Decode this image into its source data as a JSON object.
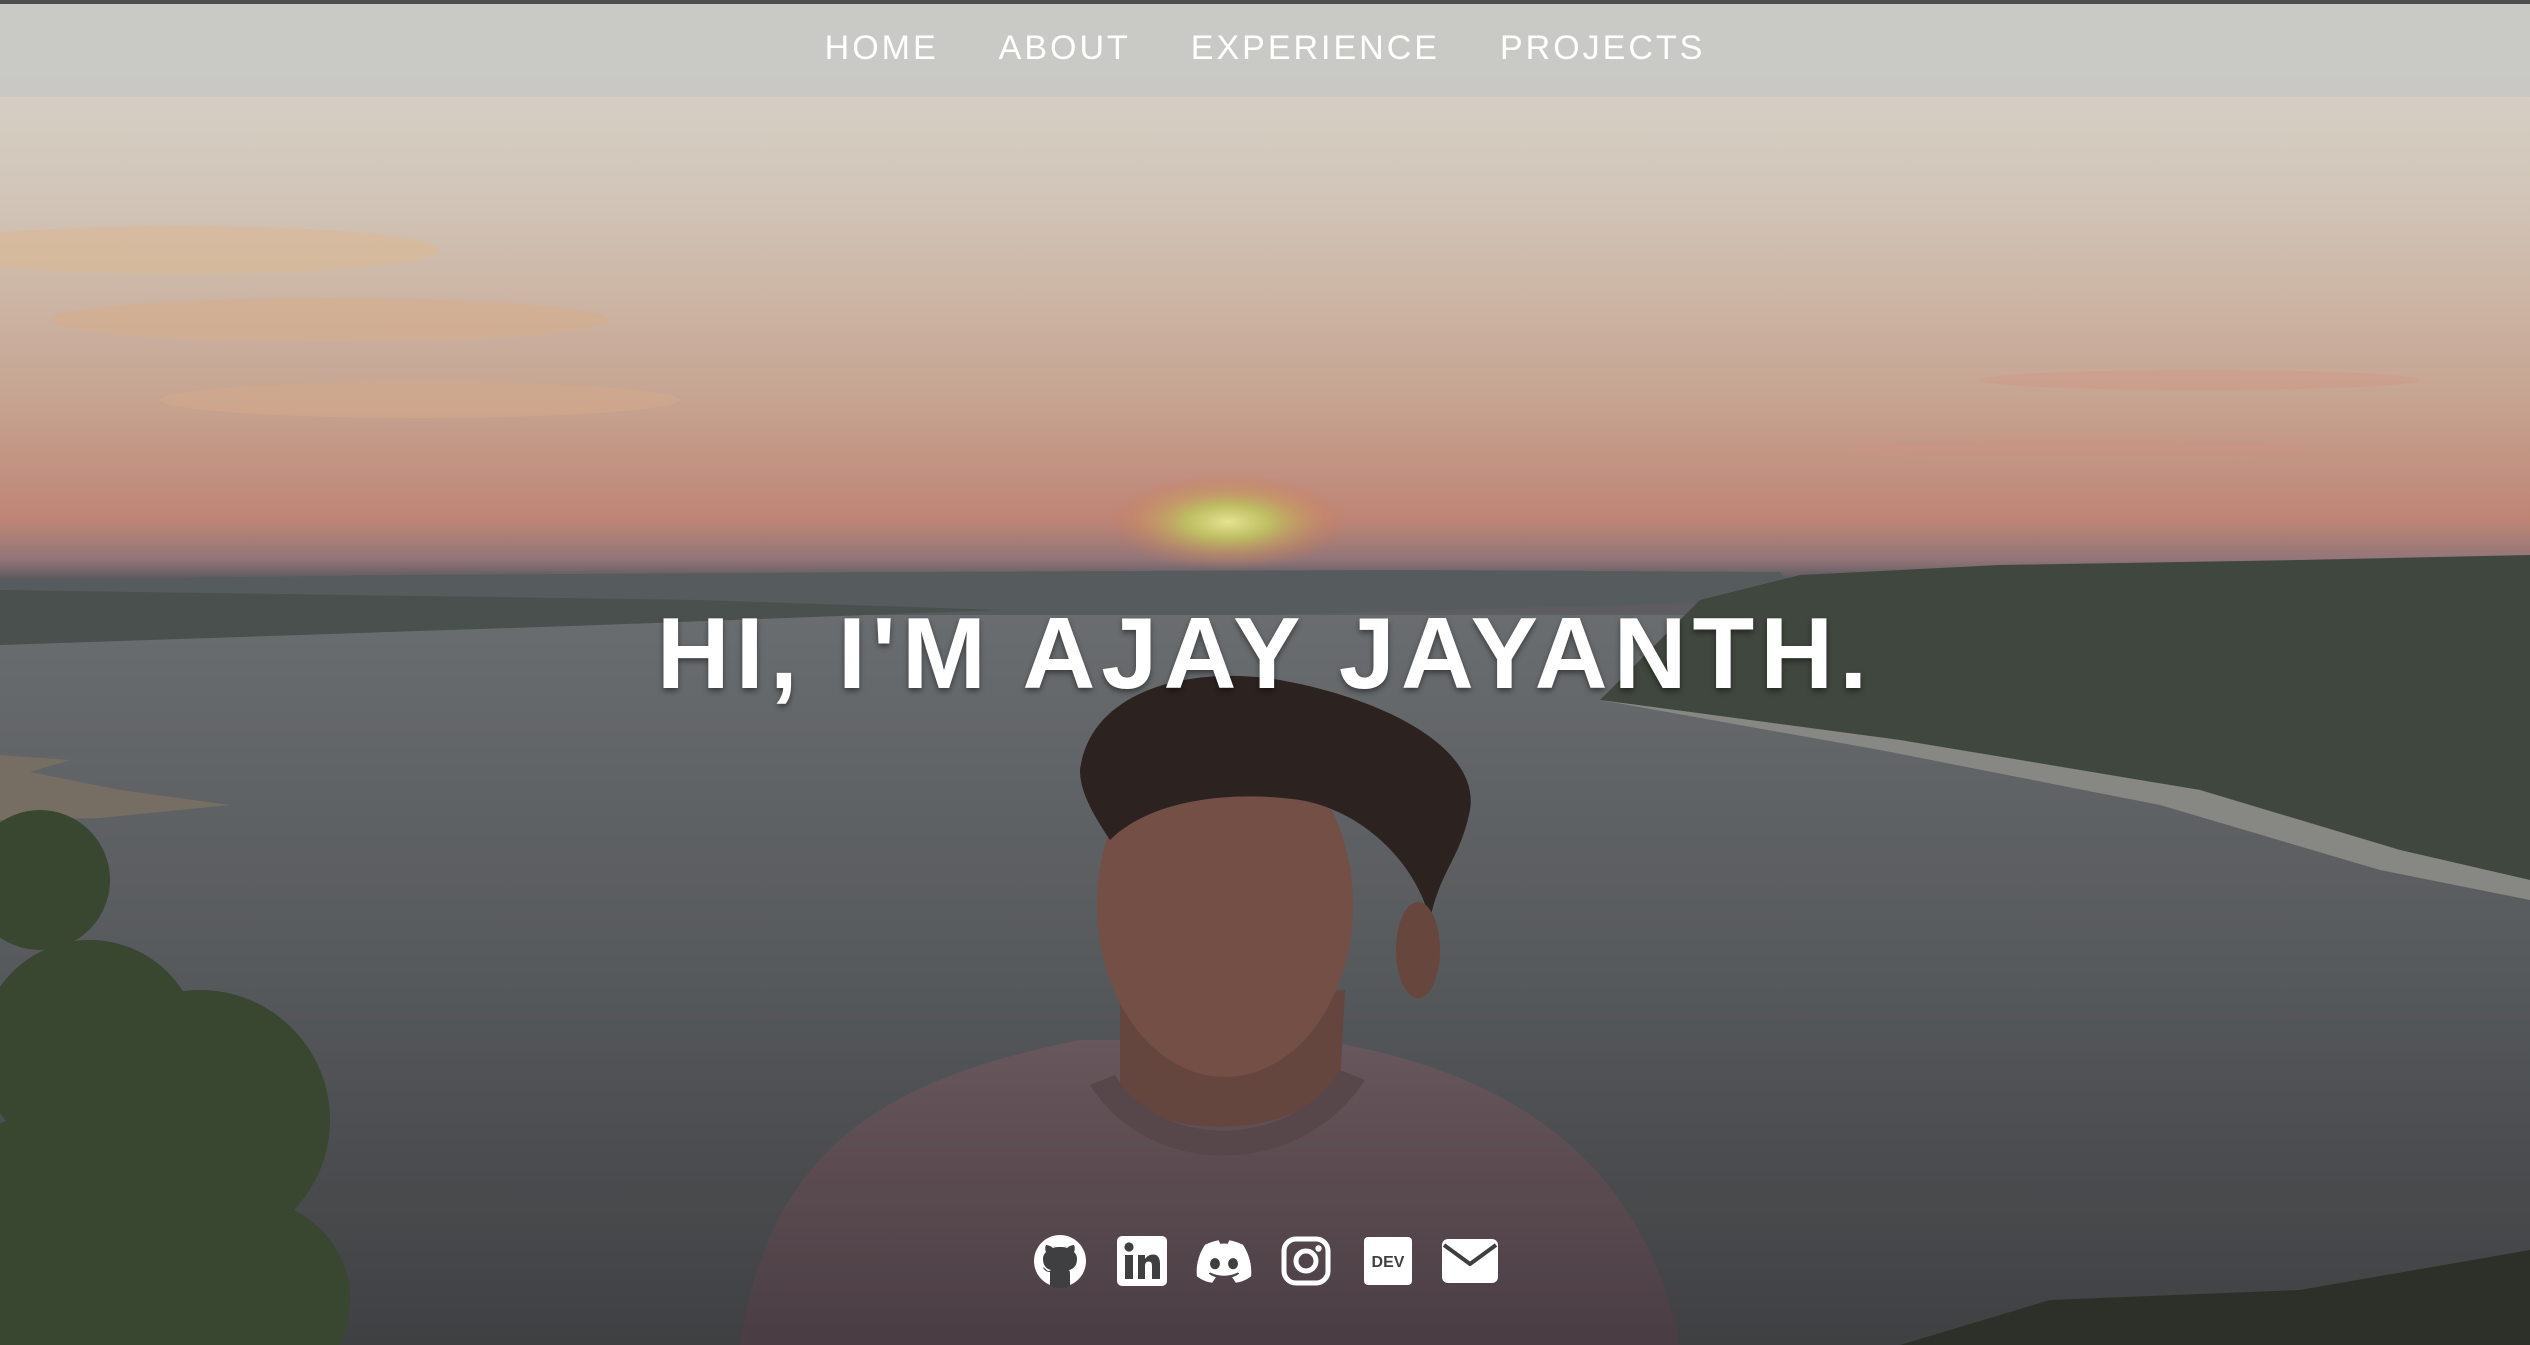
{
  "nav": {
    "items": [
      {
        "label": "HOME"
      },
      {
        "label": "ABOUT"
      },
      {
        "label": "EXPERIENCE"
      },
      {
        "label": "PROJECTS"
      }
    ]
  },
  "hero": {
    "title": "HI, I'M AJAY JAYANTH."
  },
  "social": {
    "icons": [
      "github-icon",
      "linkedin-icon",
      "discord-icon",
      "instagram-icon",
      "dev-icon",
      "email-icon"
    ],
    "dev_badge_text": "DEV"
  },
  "colors": {
    "nav_background": "#c8c8c4",
    "text": "#ffffff",
    "sunset": "#d8876e"
  }
}
